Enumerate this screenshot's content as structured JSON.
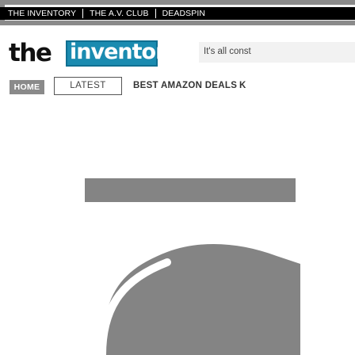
{
  "top_nav": {
    "items": [
      "THE INVENTORY",
      "THE A.V. CLUB",
      "DEADSPIN"
    ]
  },
  "brand": {
    "logo_prefix": "the",
    "logo_word": "inventory",
    "tagline": "It's all const"
  },
  "section_nav": {
    "home_label": "HOME",
    "latest_label": "LATEST",
    "links": [
      "BEST AMAZON DEALS",
      "K"
    ]
  },
  "colors": {
    "logo_blue": "#1a8bb0",
    "placeholder_gray": "#848484",
    "home_gray": "#8a8a8a"
  },
  "icons": {
    "loading": "loading-spinner-icon"
  }
}
